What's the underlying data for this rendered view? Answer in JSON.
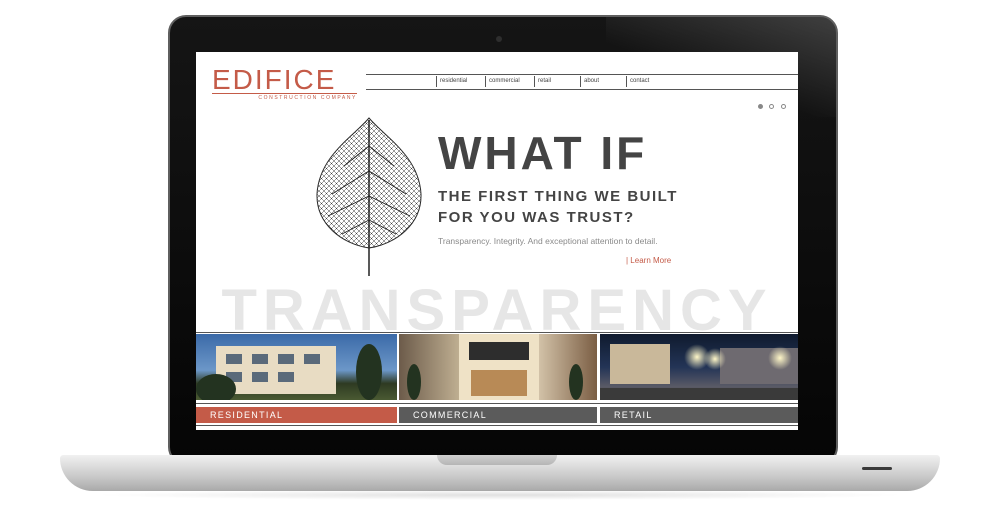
{
  "site": {
    "logo": {
      "name": "EDIFICE",
      "tagline": "CONSTRUCTION COMPANY"
    },
    "nav": [
      {
        "label": "residential"
      },
      {
        "label": "commercial"
      },
      {
        "label": "retail"
      },
      {
        "label": "about"
      },
      {
        "label": "contact"
      }
    ],
    "slider": {
      "count": 3,
      "active_index": 0
    },
    "hero": {
      "headline": "WHAT IF",
      "subline_1": "THE FIRST THING WE BUILT",
      "subline_2": "FOR YOU WAS TRUST?",
      "tagline": "Transparency. Integrity. And exceptional attention to detail.",
      "cta": "| Learn More",
      "background_word": "TRANSPARENCY"
    },
    "categories": [
      {
        "label": "RESIDENTIAL",
        "color": "#c45b48"
      },
      {
        "label": "COMMERCIAL",
        "color": "#5b5b5b"
      },
      {
        "label": "RETAIL",
        "color": "#5b5b5b"
      }
    ],
    "colors": {
      "accent": "#c45b48",
      "text": "#444444",
      "muted": "#8a8a8a"
    }
  }
}
